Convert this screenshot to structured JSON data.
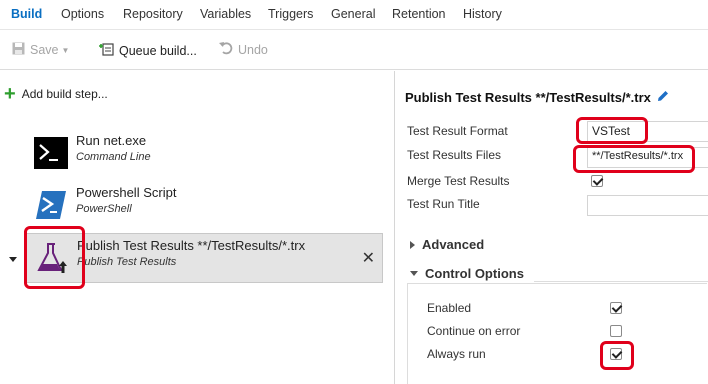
{
  "tabs": [
    {
      "label": "Build",
      "active": true
    },
    {
      "label": "Options"
    },
    {
      "label": "Repository"
    },
    {
      "label": "Variables"
    },
    {
      "label": "Triggers"
    },
    {
      "label": "General"
    },
    {
      "label": "Retention"
    },
    {
      "label": "History"
    }
  ],
  "toolbar": {
    "save_label": "Save",
    "queue_label": "Queue build...",
    "undo_label": "Undo"
  },
  "left": {
    "add_step_label": "Add build step...",
    "steps": [
      {
        "title": "Run net.exe",
        "subtitle": "Command Line",
        "icon": "command-line-icon"
      },
      {
        "title": "Powershell Script",
        "subtitle": "PowerShell",
        "icon": "powershell-icon"
      },
      {
        "title": "Publish Test Results **/TestResults/*.trx",
        "subtitle": "Publish Test Results",
        "icon": "flask-upload-icon",
        "selected": true
      }
    ]
  },
  "right": {
    "title": "Publish Test Results **/TestResults/*.trx",
    "fields": {
      "format_label": "Test Result Format",
      "format_value": "VSTest",
      "files_label": "Test Results Files",
      "files_value": "**/TestResults/*.trx",
      "merge_label": "Merge Test Results",
      "merge_checked": true,
      "run_title_label": "Test Run Title",
      "run_title_value": ""
    },
    "advanced_label": "Advanced",
    "control_options_label": "Control Options",
    "control": {
      "enabled_label": "Enabled",
      "enabled_checked": true,
      "continue_label": "Continue on error",
      "continue_checked": false,
      "always_label": "Always run",
      "always_checked": true
    }
  },
  "colors": {
    "accent": "#0a6fc2",
    "highlight": "#e0001b",
    "add_plus": "#2e9e2e",
    "flask": "#68217a"
  }
}
